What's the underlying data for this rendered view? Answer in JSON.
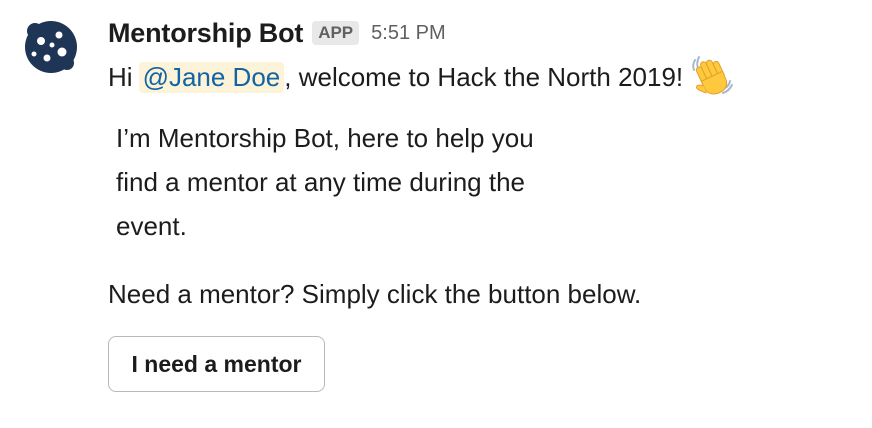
{
  "message": {
    "sender": {
      "name": "Mentorship Bot",
      "badge": "APP",
      "avatar_icon": "mentorship-bot-logo-icon",
      "avatar_color": "#1e3556"
    },
    "timestamp": "5:51 PM",
    "greeting": {
      "prefix": "Hi",
      "mention": "@Jane Doe",
      "suffix": ", welcome to Hack the North 2019!",
      "emoji_icon": "waving-hand-icon"
    },
    "intro_lines": [
      "I’m Mentorship Bot, here to help you",
      "find a mentor at any time during the",
      "event."
    ],
    "cta_text": "Need a mentor? Simply click the button below.",
    "button_label": "I need a mentor"
  },
  "colors": {
    "mention_text": "#1264a3",
    "mention_background": "#fdf3d9",
    "badge_background": "#e8e8e8",
    "muted_text": "#616061"
  }
}
